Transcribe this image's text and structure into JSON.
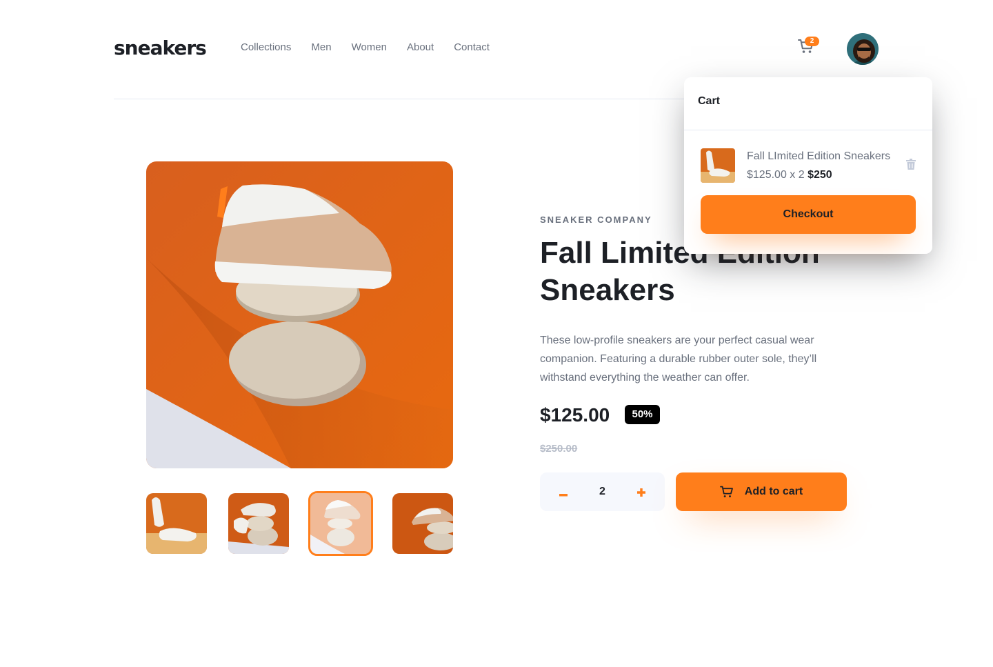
{
  "header": {
    "logo": "sneakers",
    "nav": [
      "Collections",
      "Men",
      "Women",
      "About",
      "Contact"
    ],
    "cart_count": "2",
    "cart_icon": "cart-icon",
    "avatar": "user-avatar"
  },
  "product": {
    "company": "SNEAKER COMPANY",
    "title": "Fall Limited Edition Sneakers",
    "description": "These low-profile sneakers are your perfect casual wear companion. Featuring a durable rubber outer sole, they’ll withstand everything the weather can offer.",
    "price": "$125.00",
    "discount": "50%",
    "old_price": "$250.00",
    "quantity": "2",
    "minus": "−",
    "plus": "+",
    "add_to_cart": "Add to cart"
  },
  "gallery": {
    "active_thumbnail": 3,
    "thumbnails": [
      "product-thumbnail-1",
      "product-thumbnail-2",
      "product-thumbnail-3",
      "product-thumbnail-4"
    ]
  },
  "cart": {
    "title": "Cart",
    "item_name": "Fall LImited Edition Sneakers",
    "item_calc": "$125.00 x 2",
    "item_total": "$250",
    "checkout": "Checkout"
  },
  "colors": {
    "accent": "#ff7e1b",
    "text_dark": "#1d2026",
    "text_gray": "#69707d",
    "light_bg": "#f6f8fd"
  }
}
